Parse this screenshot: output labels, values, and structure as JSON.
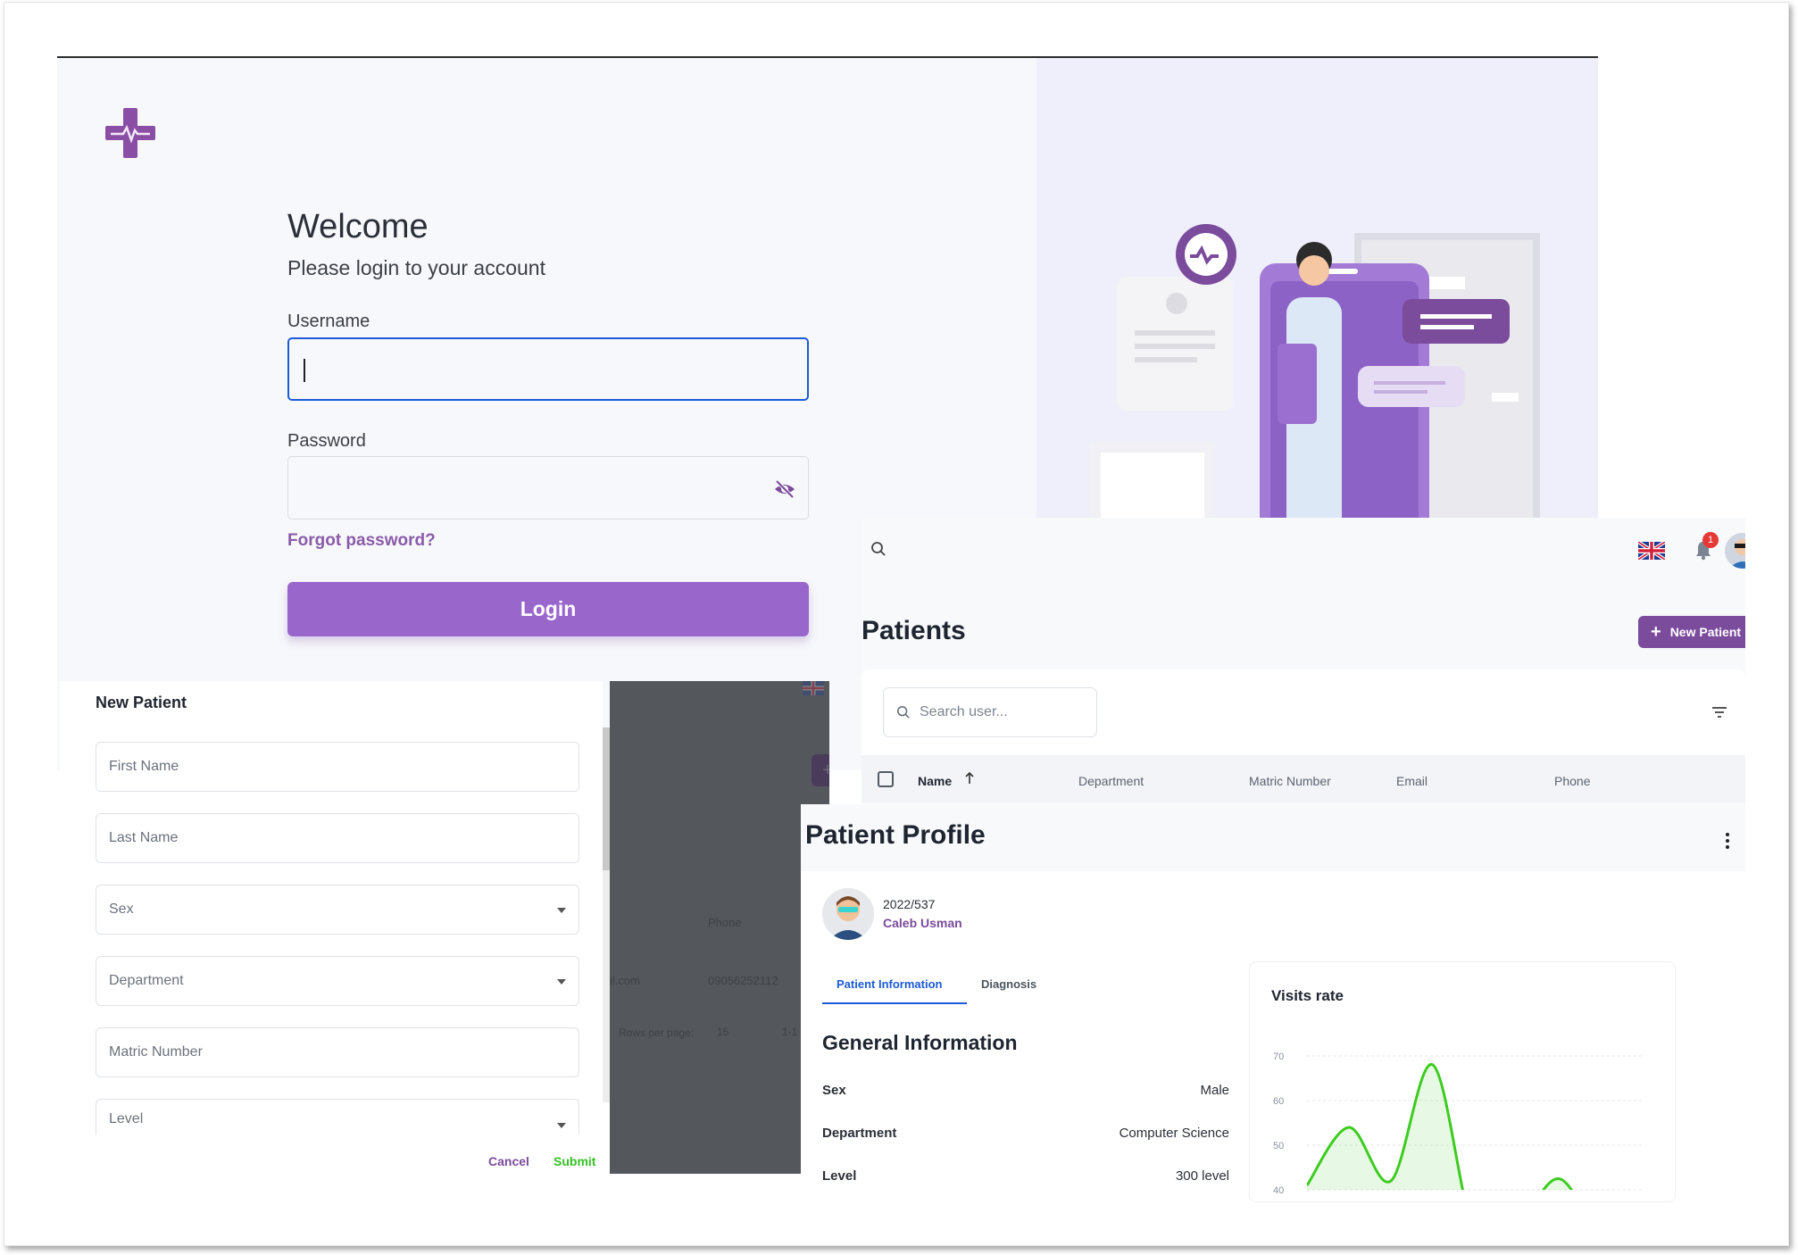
{
  "login": {
    "welcome": "Welcome",
    "subtitle": "Please login to your account",
    "username_label": "Username",
    "password_label": "Password",
    "forgot": "Forgot password?",
    "login_button": "Login"
  },
  "patients": {
    "title": "Patients",
    "new_patient_button": "New Patient",
    "search_placeholder": "Search user...",
    "notification_count": "1",
    "columns": [
      "Name",
      "Department",
      "Matric Number",
      "Email",
      "Phone"
    ]
  },
  "new_patient": {
    "title": "New Patient",
    "fields": [
      "First Name",
      "Last Name",
      "Sex",
      "Department",
      "Matric Number",
      "Level"
    ],
    "cancel": "Cancel",
    "submit": "Submit",
    "background": {
      "phone_header": "Phone",
      "email_fragment": "il.com",
      "phone_value": "09056252112",
      "rows_per_page_label": "Rows per page:",
      "rows_per_page_value": "15",
      "range_fragment": "1-1"
    }
  },
  "profile": {
    "title": "Patient Profile",
    "matric": "2022/537",
    "name": "Caleb Usman",
    "tabs": [
      "Patient Information",
      "Diagnosis"
    ],
    "section_title": "General Information",
    "info": [
      {
        "label": "Sex",
        "value": "Male"
      },
      {
        "label": "Department",
        "value": "Computer Science"
      },
      {
        "label": "Level",
        "value": "300 level"
      }
    ],
    "visits_title": "Visits rate"
  },
  "colors": {
    "primary": "#9966cc",
    "primary_dark": "#7b4b9c",
    "accent_blue": "#1c5bd6",
    "success": "#35c024",
    "chart_line": "#3ccc1f"
  },
  "chart_data": {
    "type": "area",
    "title": "Visits rate",
    "xlabel": "",
    "ylabel": "",
    "ylim": [
      40,
      70
    ],
    "yticks": [
      70,
      60,
      50,
      40
    ],
    "grid": true,
    "x": [
      0,
      1,
      2,
      3,
      4,
      5,
      6,
      7,
      8
    ],
    "series": [
      {
        "values": [
          41,
          54,
          42,
          68,
          30,
          32,
          42.5,
          30,
          30
        ]
      }
    ]
  }
}
